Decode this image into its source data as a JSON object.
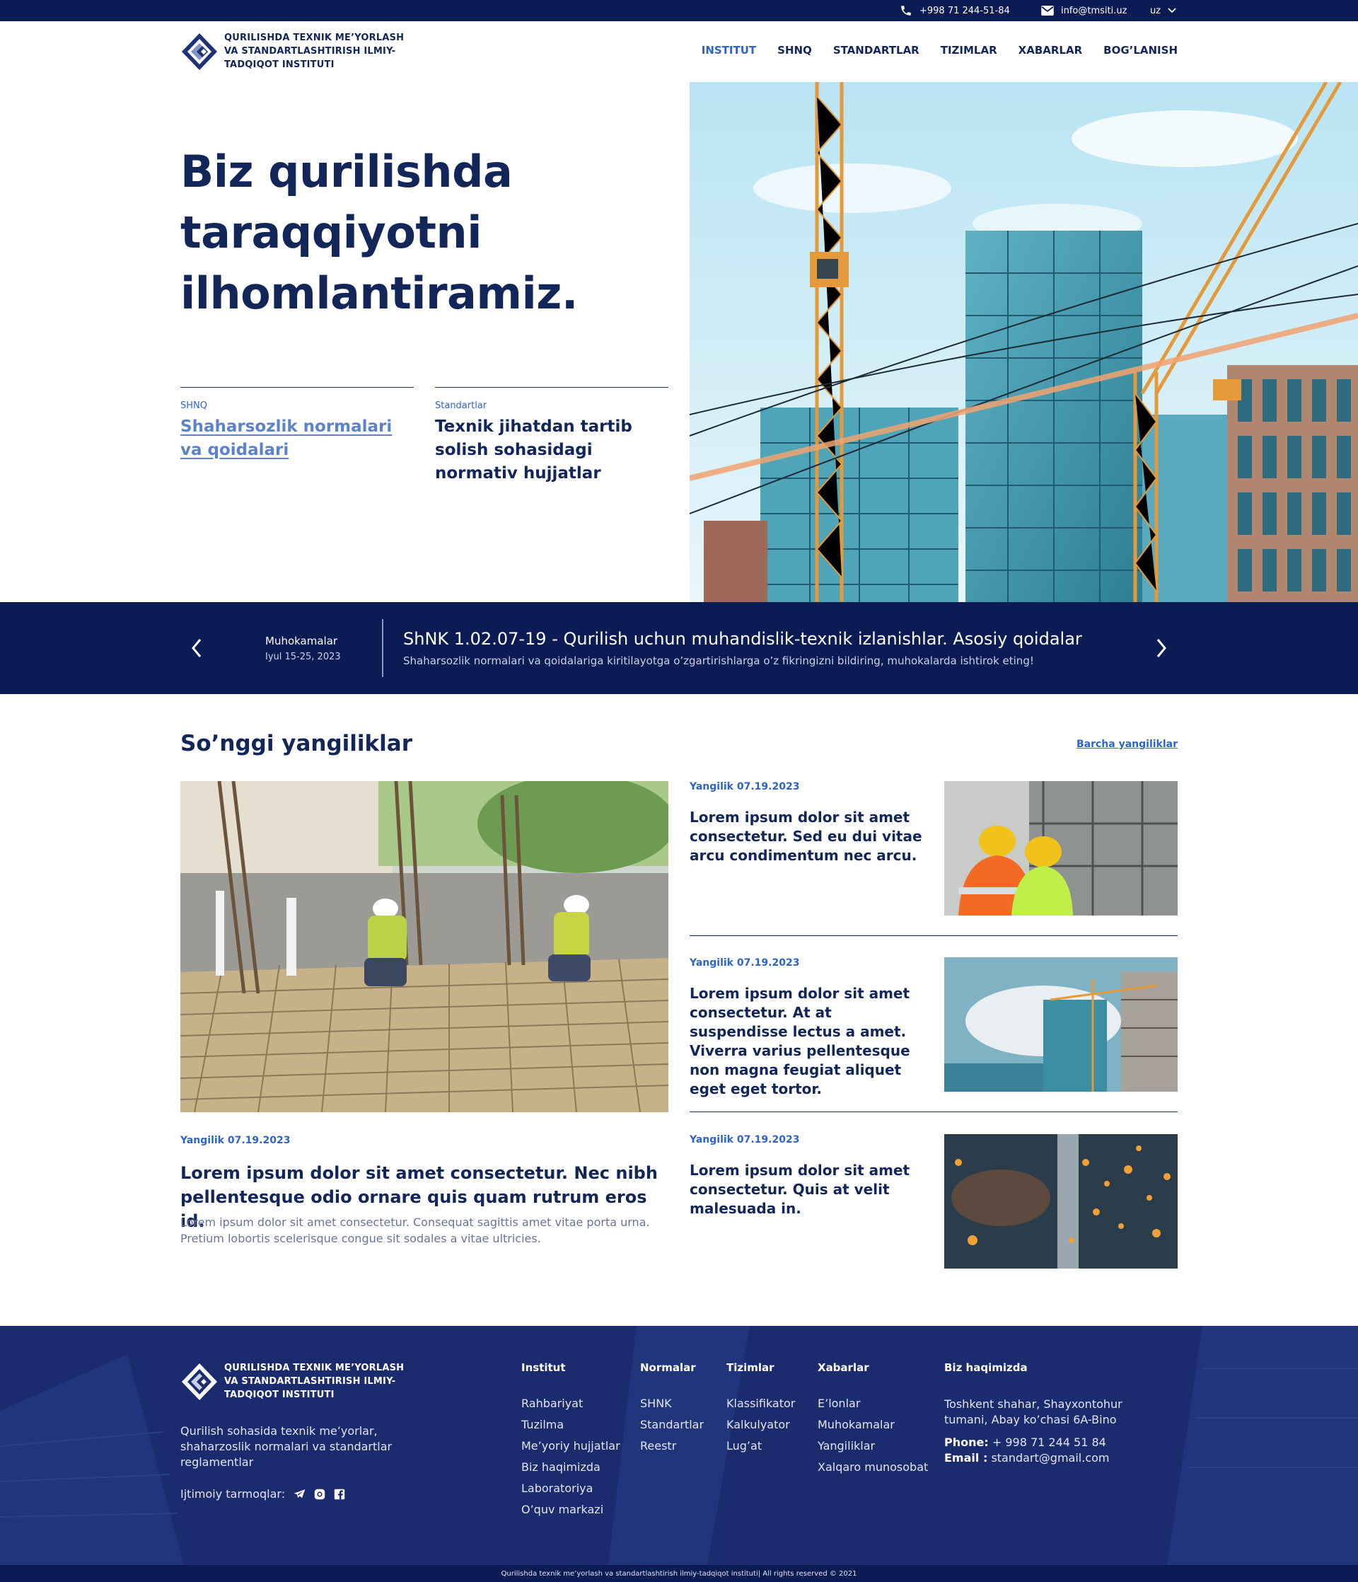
{
  "topbar": {
    "phone": "+998 71 244-51-84",
    "email": "info@tmsiti.uz",
    "lang": "uz"
  },
  "header": {
    "logo_text": "QURILISHDA TEXNIK ME’YORLASH VA STANDARTLASHTIRISH ILMIY-TADQIQOT INSTITUTI",
    "nav": [
      "INSTITUT",
      "SHNQ",
      "STANDARTLAR",
      "TIZIMLAR",
      "XABARLAR",
      "BOG’LANISH"
    ],
    "active_nav": "INSTITUT"
  },
  "hero": {
    "title": "Biz qurilishda taraqqiyotni ilhomlantiramiz.",
    "cards": [
      {
        "category": "SHNQ",
        "title": "Shaharsozlik normalari va qoidalari"
      },
      {
        "category": "Standartlar",
        "title": "Texnik jihatdan tartib solish sohasidagi normativ hujjatlar"
      }
    ]
  },
  "banner": {
    "label": "Muhokamalar",
    "date": "Iyul 15-25, 2023",
    "title": "ShNK 1.02.07-19 - Qurilish uchun muhandislik-texnik izlanishlar. Asosiy qoidalar",
    "subtitle": "Shaharsozlik normalari va qoidalariga kiritilayotga o’zgartirishlarga o’z fikringizni bildiring, muhokalarda ishtirok eting!"
  },
  "news": {
    "heading": "So’nggi yangiliklar",
    "all_link": "Barcha yangiliklar",
    "featured": {
      "tag": "Yangilik 07.19.2023",
      "title": "Lorem ipsum dolor sit amet consectetur. Nec nibh pellentesque odio ornare quis quam rutrum eros id.",
      "description": "Lorem ipsum dolor sit amet consectetur. Consequat sagittis amet vitae porta urna. Pretium lobortis scelerisque congue sit sodales a vitae ultricies."
    },
    "items": [
      {
        "tag": "Yangilik 07.19.2023",
        "title": "Lorem ipsum dolor sit amet consectetur. Sed eu dui vitae arcu condimentum nec arcu."
      },
      {
        "tag": "Yangilik 07.19.2023",
        "title": "Lorem ipsum dolor sit amet consectetur. At at suspendisse lectus a amet. Viverra varius pellentesque non magna feugiat aliquet eget eget tortor."
      },
      {
        "tag": "Yangilik 07.19.2023",
        "title": "Lorem ipsum dolor sit amet consectetur. Quis at velit malesuada in."
      }
    ]
  },
  "footer": {
    "logo_text": "QURILISHDA TEXNIK ME’YORLASH VA STANDARTLASHTIRISH ILMIY-TADQIQOT INSTITUTI",
    "description": "Qurilish sohasida texnik me’yorlar, shaharzoslik normalari va standartlar reglamentlar",
    "social_label": "Ijtimoiy tarmoqlar:",
    "social_icons": [
      "telegram-icon",
      "instagram-icon",
      "facebook-icon"
    ],
    "columns": [
      {
        "heading": "Institut",
        "links": [
          "Rahbariyat",
          "Tuzilma",
          "Me’yoriy hujjatlar",
          "Biz haqimizda",
          "Laboratoriya",
          "O’quv markazi"
        ]
      },
      {
        "heading": "Normalar",
        "links": [
          "SHNK",
          "Standartlar",
          "Reestr"
        ]
      },
      {
        "heading": "Tizimlar",
        "links": [
          "Klassifikator",
          "Kalkulyator",
          "Lug’at"
        ]
      },
      {
        "heading": "Xabarlar",
        "links": [
          "E’lonlar",
          "Muhokamalar",
          "Yangiliklar",
          "Xalqaro munosobat"
        ]
      }
    ],
    "about": {
      "heading": "Biz haqimizda",
      "address": "Toshkent shahar, Shayxontohur tumani, Abay ko’chasi 6A-Bino",
      "phone_label": "Phone:",
      "phone": "+ 998 71 244 51 84",
      "email_label": "Email :",
      "email": "standart@gmail.com"
    },
    "copyright": "Qurilishda texnik me’yorlash va standartlashtirish ilmiy-tadqiqot instituti| All rights reserved © 2021"
  },
  "colors": {
    "navy": "#0b1c54",
    "brand_text": "#13265a",
    "accent_blue": "#2e64c9",
    "footer_bg": "#1b2c6e"
  }
}
